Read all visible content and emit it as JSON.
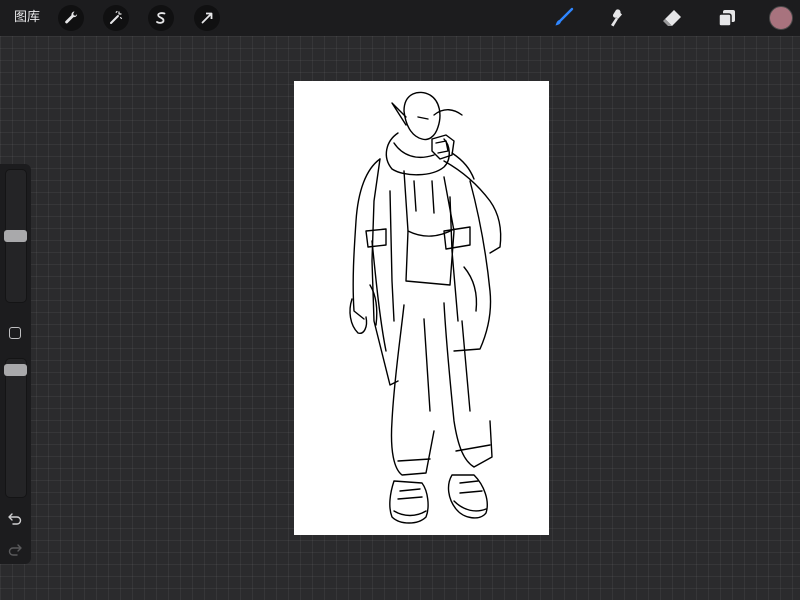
{
  "topbar": {
    "gallery_label": "图库",
    "left_tools": [
      {
        "name": "actions",
        "icon": "wrench-icon"
      },
      {
        "name": "adjustments",
        "icon": "magic-wand-icon"
      },
      {
        "name": "selection",
        "icon": "selection-s-icon"
      },
      {
        "name": "transform",
        "icon": "arrow-cursor-icon"
      }
    ],
    "right_tools": [
      {
        "name": "brush",
        "icon": "brush-icon",
        "active": true
      },
      {
        "name": "smudge",
        "icon": "smudge-icon"
      },
      {
        "name": "eraser",
        "icon": "eraser-icon"
      },
      {
        "name": "layers",
        "icon": "layers-icon"
      }
    ],
    "current_color": "#a8737e"
  },
  "colors": {
    "accent": "#2f86ff",
    "toolbar_bg": "#1c1c1e",
    "workspace_bg": "#2b2b2d",
    "canvas_bg": "#ffffff"
  },
  "sidebar": {
    "brush_size_level": 0.5,
    "brush_opacity_level": 0.95,
    "icons": [
      "modify-square-icon",
      "undo-icon",
      "redo-icon"
    ]
  },
  "canvas": {
    "content": "line-art-illustration"
  }
}
